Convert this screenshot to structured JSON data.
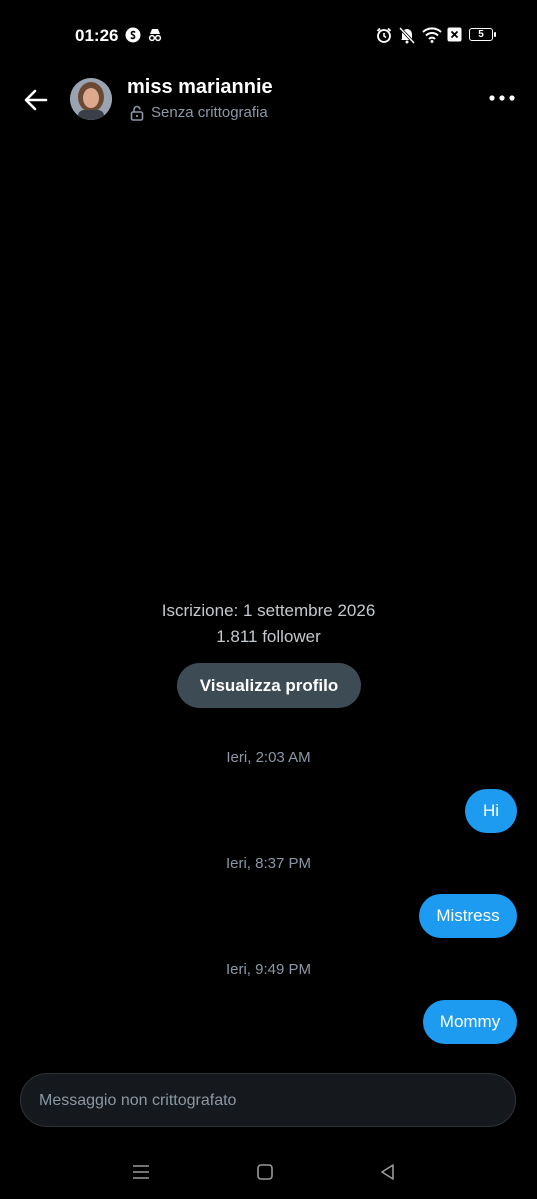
{
  "status_bar": {
    "time": "01:26",
    "battery": "5",
    "left_icons": [
      "shazam-icon",
      "incognito-icon"
    ],
    "right_icons": [
      "alarm-icon",
      "mute-icon",
      "wifi-icon",
      "sim-off-icon",
      "battery-icon"
    ]
  },
  "header": {
    "name": "miss mariannie",
    "encryption_status": "Senza crittografia"
  },
  "profile_info": {
    "joined": "Iscrizione: 1 settembre 2026",
    "followers": "1.811 follower",
    "view_profile_label": "Visualizza profilo"
  },
  "messages": [
    {
      "timestamp": "Ieri, 2:03 AM",
      "text": "Hi"
    },
    {
      "timestamp": "Ieri, 8:37 PM",
      "text": "Mistress"
    },
    {
      "timestamp": "Ieri, 9:49 PM",
      "text": "Mommy"
    }
  ],
  "composer": {
    "placeholder": "Messaggio non crittografato"
  },
  "colors": {
    "background": "#000000",
    "bubble": "#1d9bf0",
    "button": "#3d4b55",
    "muted_text": "#8b98a5"
  }
}
